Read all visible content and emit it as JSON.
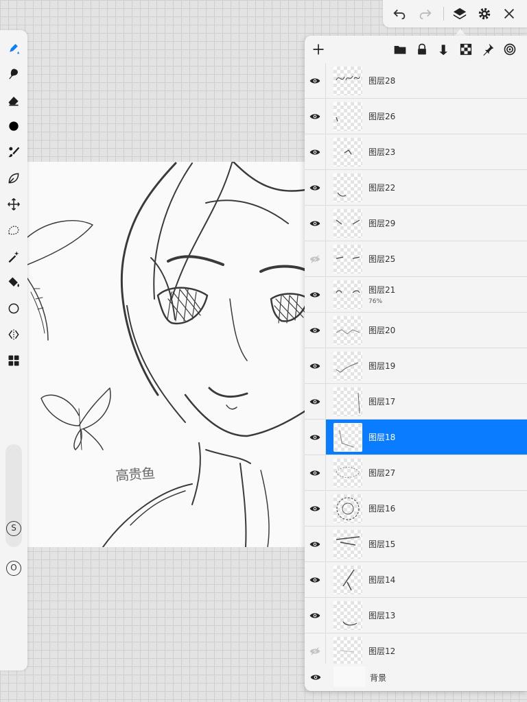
{
  "top_toolbar": {
    "buttons": [
      {
        "name": "undo-icon"
      },
      {
        "name": "redo-icon"
      },
      {
        "name": "layers-icon"
      },
      {
        "name": "settings-icon"
      },
      {
        "name": "close-icon"
      }
    ]
  },
  "left_toolbar": {
    "tools": [
      "pen-tool-icon",
      "smudge-brush-icon",
      "eraser-icon",
      "color-circle-icon",
      "brush-picker-icon",
      "lasso-leaf-icon",
      "move-icon",
      "lasso-select-icon",
      "magic-wand-icon",
      "fill-bucket-icon",
      "shape-circle-icon",
      "symmetry-icon",
      "grid-view-icon"
    ],
    "size_button": "S",
    "opacity_button": "O"
  },
  "layer_panel": {
    "header_icons": [
      "add-layer-icon",
      "folder-icon",
      "lock-icon",
      "merge-down-icon",
      "transparency-icon",
      "pin-icon",
      "reference-icon"
    ],
    "layers": [
      {
        "name": "图层28",
        "visible": true
      },
      {
        "name": "图层26",
        "visible": true
      },
      {
        "name": "图层23",
        "visible": true
      },
      {
        "name": "图层22",
        "visible": true
      },
      {
        "name": "图层29",
        "visible": true
      },
      {
        "name": "图层25",
        "visible": false
      },
      {
        "name": "图层21",
        "visible": true,
        "opacity": "76%"
      },
      {
        "name": "图层20",
        "visible": true
      },
      {
        "name": "图层19",
        "visible": true
      },
      {
        "name": "图层17",
        "visible": true
      },
      {
        "name": "图层18",
        "visible": true,
        "selected": true
      },
      {
        "name": "图层27",
        "visible": true
      },
      {
        "name": "图层16",
        "visible": true
      },
      {
        "name": "图层15",
        "visible": true
      },
      {
        "name": "图层14",
        "visible": true
      },
      {
        "name": "图层13",
        "visible": true
      },
      {
        "name": "图层12",
        "visible": false
      }
    ],
    "background": {
      "name": "背景",
      "visible": true
    }
  },
  "canvas": {
    "signature": "高贵鱼"
  },
  "colors": {
    "accent": "#0a7cff",
    "panel": "#f4f4f4",
    "grid": "#cfcfcf"
  }
}
